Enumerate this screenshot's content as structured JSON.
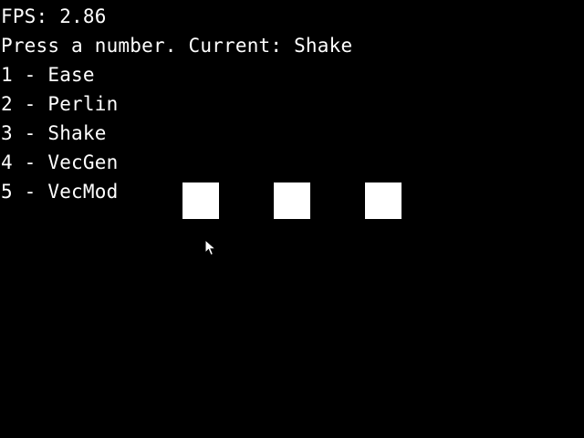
{
  "hud": {
    "fps_text": "FPS: 2.86",
    "prompt_text": "Press a number. Current: Shake"
  },
  "menu": {
    "items": [
      {
        "label": "1 - Ease"
      },
      {
        "label": "2 - Perlin"
      },
      {
        "label": "3 - Shake"
      },
      {
        "label": "4 - VecGen"
      },
      {
        "label": "5 - VecMod"
      }
    ]
  },
  "scene": {
    "box_color": "#ffffff",
    "background_color": "#000000",
    "cursor_icon": "arrow-pointer-icon"
  }
}
